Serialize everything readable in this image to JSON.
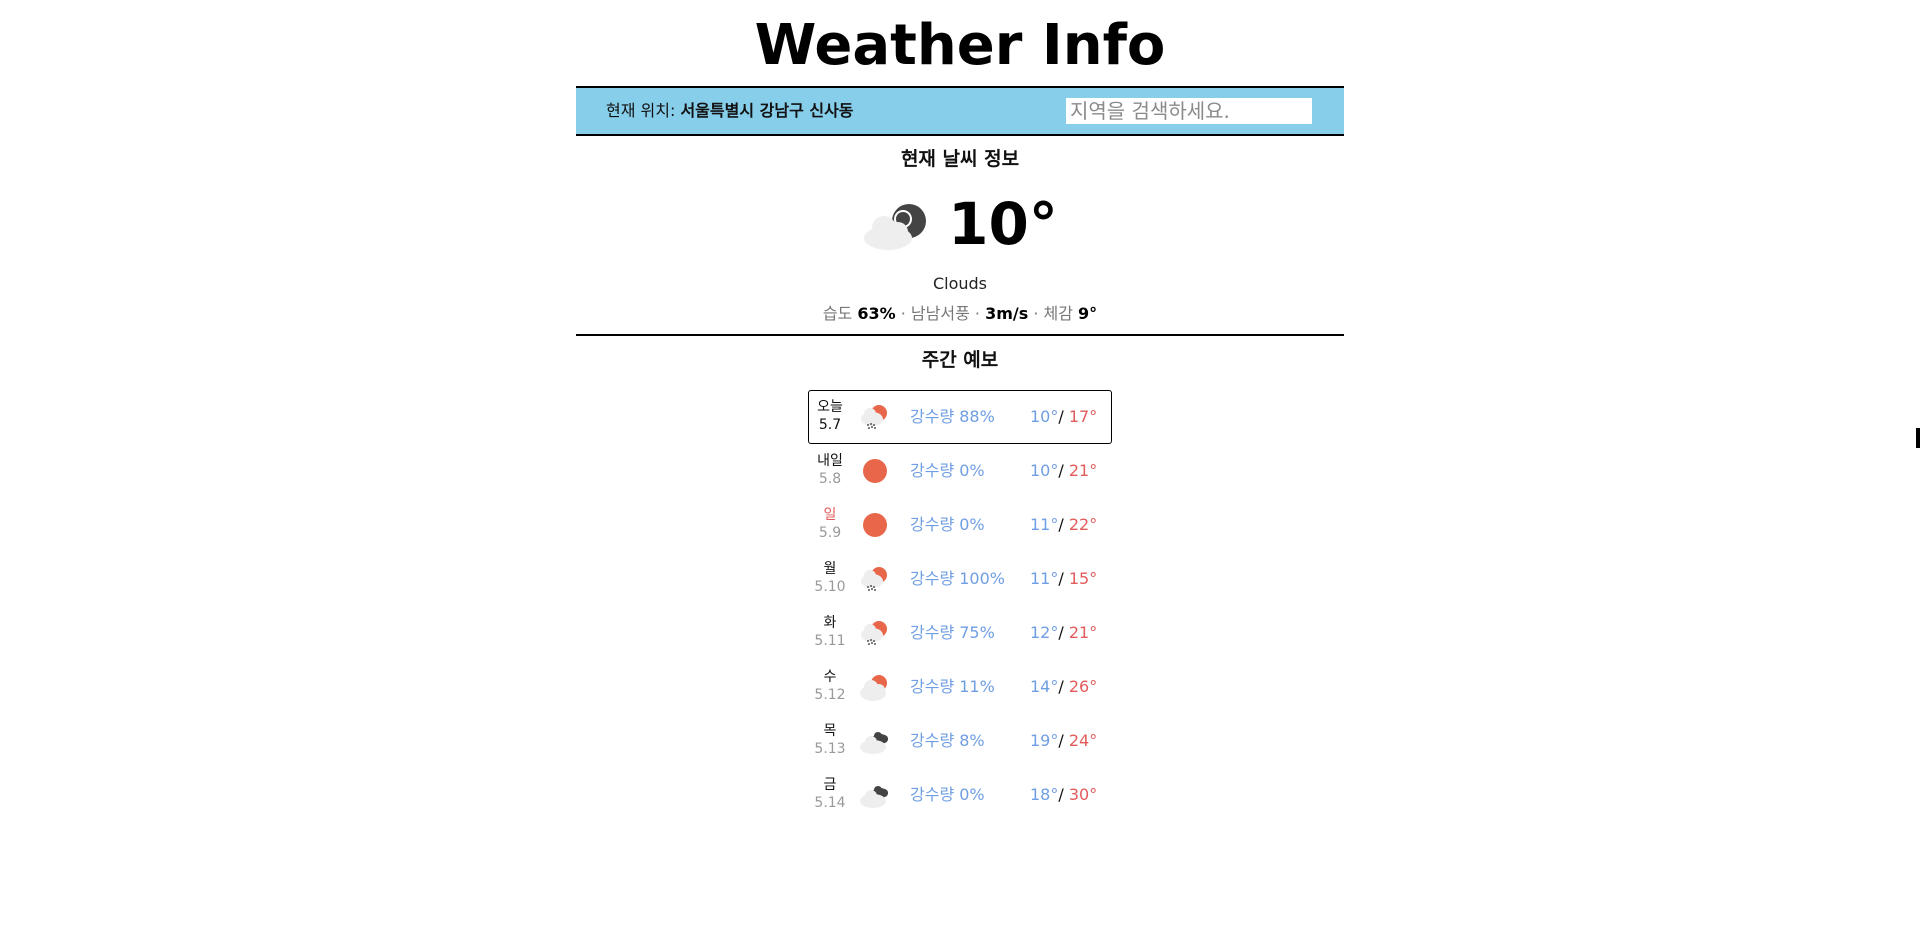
{
  "app": {
    "title": "Weather Info"
  },
  "location": {
    "label": "현재 위치: ",
    "value": "서울특별시 강남구 신사동"
  },
  "search": {
    "placeholder": "지역을 검색하세요."
  },
  "current": {
    "title": "현재 날씨 정보",
    "icon": "cloud-moon-icon",
    "temperature": "10°",
    "description": "Clouds",
    "humidity_label": "습도 ",
    "humidity_value": "63%",
    "wind_dir": "남남서풍",
    "wind_value": "3m/s",
    "feels_label": "체감 ",
    "feels_value": "9°",
    "separator": " · "
  },
  "weekly": {
    "title": "주간 예보",
    "items": [
      {
        "day": "오늘",
        "date": "5.7",
        "icon": "rain-sun-icon",
        "precip": "강수량 88%",
        "min": "10°",
        "sep": "/ ",
        "max": "17°",
        "sunday": false,
        "selected": true
      },
      {
        "day": "내일",
        "date": "5.8",
        "icon": "sun-icon",
        "precip": "강수량 0%",
        "min": "10°",
        "sep": "/ ",
        "max": "21°",
        "sunday": false,
        "selected": false
      },
      {
        "day": "일",
        "date": "5.9",
        "icon": "sun-icon",
        "precip": "강수량 0%",
        "min": "11°",
        "sep": "/ ",
        "max": "22°",
        "sunday": true,
        "selected": false
      },
      {
        "day": "월",
        "date": "5.10",
        "icon": "rain-sun-icon",
        "precip": "강수량 100%",
        "min": "11°",
        "sep": "/ ",
        "max": "15°",
        "sunday": false,
        "selected": false
      },
      {
        "day": "화",
        "date": "5.11",
        "icon": "rain-sun-icon",
        "precip": "강수량 75%",
        "min": "12°",
        "sep": "/ ",
        "max": "21°",
        "sunday": false,
        "selected": false
      },
      {
        "day": "수",
        "date": "5.12",
        "icon": "cloud-sun-icon",
        "precip": "강수량 11%",
        "min": "14°",
        "sep": "/ ",
        "max": "26°",
        "sunday": false,
        "selected": false
      },
      {
        "day": "목",
        "date": "5.13",
        "icon": "cloudy-icon",
        "precip": "강수량 8%",
        "min": "19°",
        "sep": "/ ",
        "max": "24°",
        "sunday": false,
        "selected": false
      },
      {
        "day": "금",
        "date": "5.14",
        "icon": "cloudy-icon",
        "precip": "강수량 0%",
        "min": "18°",
        "sep": "/ ",
        "max": "30°",
        "sunday": false,
        "selected": false
      }
    ]
  },
  "colors": {
    "header_bg": "#87ceeb",
    "min_temp": "#6f9ee3",
    "max_temp": "#e25b5b",
    "sun": "#e8674a"
  }
}
